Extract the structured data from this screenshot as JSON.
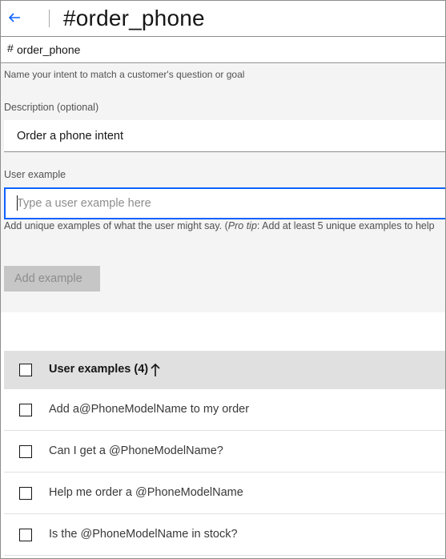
{
  "header": {
    "back_icon": "arrow-left-icon",
    "title": "#order_phone"
  },
  "intent_name": {
    "hash": "#",
    "value": "order_phone",
    "helper": "Name your intent to match a customer's question or goal"
  },
  "description": {
    "label": "Description (optional)",
    "value": "Order a phone intent"
  },
  "user_example": {
    "label": "User example",
    "placeholder": "Type a user example here",
    "helper_prefix": "Add unique examples of what the user might say. (",
    "helper_tip": "Pro tip",
    "helper_suffix": ": Add at least 5 unique examples to help",
    "add_button": "Add example"
  },
  "table": {
    "header_label": "User examples (4)",
    "sort_icon": "arrow-up-icon",
    "rows": [
      "Add a@PhoneModelName to my order",
      "Can I get a @PhoneModelName?",
      "Help me order a @PhoneModelName",
      "Is the @PhoneModelName in stock?"
    ]
  },
  "colors": {
    "accent": "#0f62fe",
    "panel": "#f4f4f4",
    "disabled_button": "#c6c6c6",
    "table_header": "#e0e0e0"
  }
}
